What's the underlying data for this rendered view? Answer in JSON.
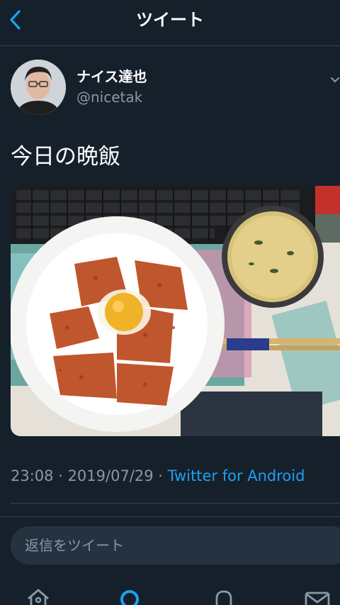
{
  "header": {
    "title": "ツイート",
    "back_icon": "chevron-left-icon"
  },
  "tweet": {
    "author": {
      "display_name": "ナイス達也",
      "handle": "@nicetak"
    },
    "text": "今日の晩飯",
    "photo": {
      "description": "bowl of rice topped with seasoned pork and raw egg, miso soup, keyboard"
    },
    "meta": {
      "time": "23:08",
      "separator": " · ",
      "date": "2019/07/29",
      "source": "Twitter for Android"
    }
  },
  "reply": {
    "placeholder": "返信をツイート"
  },
  "nav": {
    "items": [
      "home-icon",
      "search-icon",
      "notifications-icon",
      "messages-icon"
    ],
    "active": "search-icon"
  },
  "colors": {
    "background": "#15202b",
    "accent": "#1da1f2",
    "secondary_text": "#8899a6",
    "divider": "#38444d"
  }
}
